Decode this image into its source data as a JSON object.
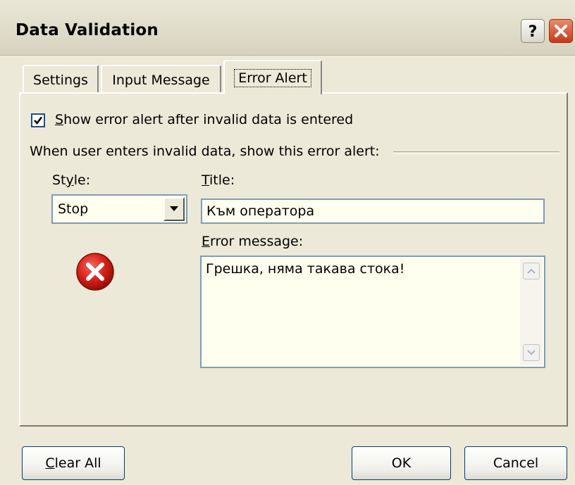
{
  "window": {
    "title": "Data Validation"
  },
  "tabs": [
    {
      "label": "Settings"
    },
    {
      "label": "Input Message"
    },
    {
      "label": "Error Alert"
    }
  ],
  "error_alert": {
    "show_checkbox": {
      "mnemonic": "S",
      "rest": "how error alert after invalid data is entered",
      "checked": true
    },
    "group_label": "When user enters invalid data, show this error alert:",
    "style": {
      "pre": "St",
      "mnemonic": "y",
      "post": "le:",
      "value": "Stop",
      "icon": "stop-error-icon"
    },
    "title": {
      "mnemonic": "T",
      "rest": "itle:",
      "value": "Към оператора"
    },
    "error_message": {
      "mnemonic": "E",
      "rest": "rror message:",
      "value": "Грешка, няма такава стока!"
    }
  },
  "buttons": {
    "clear_all": {
      "mnemonic": "C",
      "rest": "lear All"
    },
    "ok": "OK",
    "cancel": "Cancel"
  },
  "colors": {
    "window_bg": "#ece9d8",
    "field_bg": "#fffff0",
    "field_border": "#7f9db9",
    "stop_red": "#d8241c"
  }
}
